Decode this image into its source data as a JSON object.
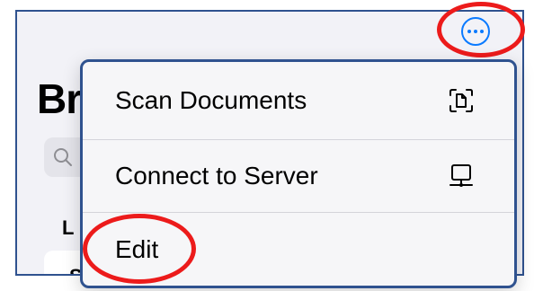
{
  "page": {
    "title_partial": "Br",
    "section_letter": "L",
    "row_letter": "S"
  },
  "toolbar": {
    "more_icon": "ellipsis-circle-icon"
  },
  "menu": {
    "items": [
      {
        "label": "Scan Documents",
        "icon": "doc-viewfinder-icon"
      },
      {
        "label": "Connect to Server",
        "icon": "desktop-computer-icon"
      },
      {
        "label": "Edit",
        "icon": ""
      }
    ]
  },
  "colors": {
    "accent": "#0a7aff",
    "annotation": "#ec1b1b",
    "frame_border": "#2f528f"
  }
}
